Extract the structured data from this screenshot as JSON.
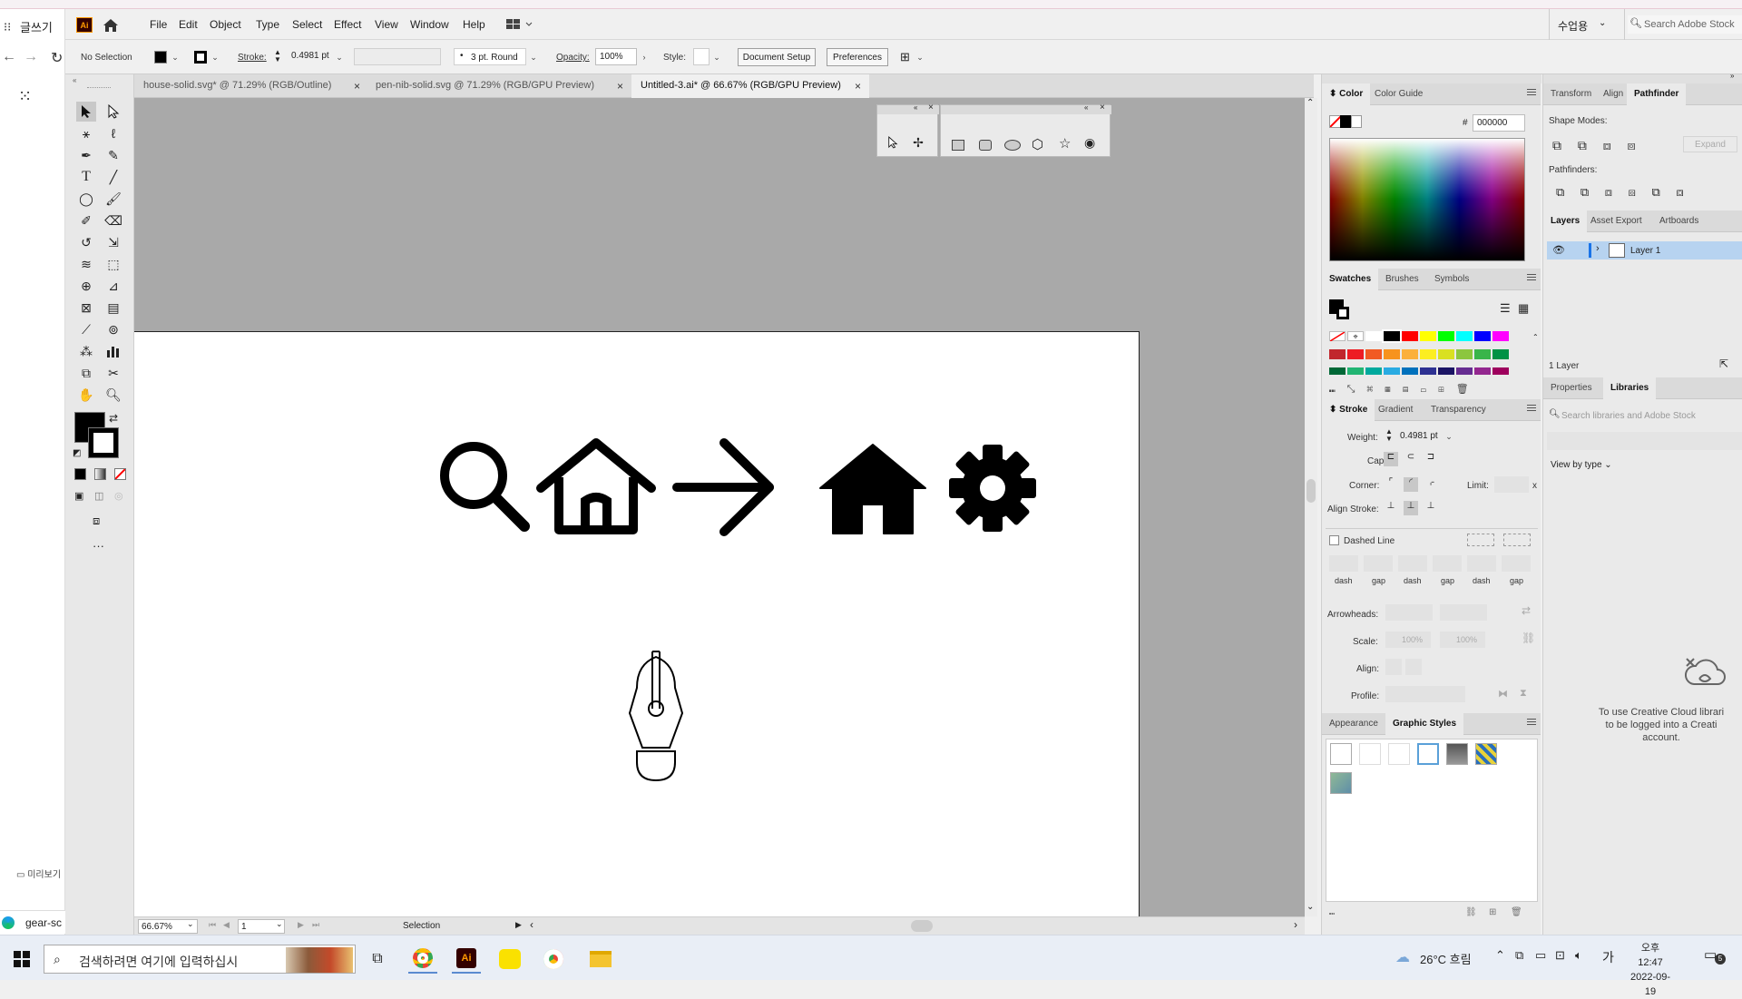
{
  "left_app": {
    "title": "글쓰기",
    "preview_label": "미리보기",
    "bottom_tab": "gear-sc"
  },
  "app": {
    "logo": "Ai"
  },
  "menu": [
    "File",
    "Edit",
    "Object",
    "Type",
    "Select",
    "Effect",
    "View",
    "Window",
    "Help"
  ],
  "header_right": {
    "workspace": "수업용",
    "search_placeholder": "Search Adobe Stock"
  },
  "control": {
    "selection": "No Selection",
    "stroke_label": "Stroke:",
    "stroke_value": "0.4981 pt",
    "brush": "3 pt. Round",
    "opacity_label": "Opacity:",
    "opacity_value": "100%",
    "style_label": "Style:",
    "doc_setup": "Document Setup",
    "preferences": "Preferences"
  },
  "tabs": [
    {
      "label": "house-solid.svg* @ 71.29% (RGB/Outline)",
      "active": false
    },
    {
      "label": "pen-nib-solid.svg @ 71.29% (RGB/GPU Preview)",
      "active": false
    },
    {
      "label": "Untitled-3.ai* @ 66.67% (RGB/GPU Preview)",
      "active": true
    }
  ],
  "status": {
    "zoom": "66.67%",
    "artboard": "1",
    "tool": "Selection"
  },
  "color_panel": {
    "tabs": [
      "Color",
      "Color Guide"
    ],
    "hex_label": "#",
    "hex": "000000"
  },
  "swatches_panel": {
    "tabs": [
      "Swatches",
      "Brushes",
      "Symbols"
    ]
  },
  "stroke_panel": {
    "tabs": [
      "Stroke",
      "Gradient",
      "Transparency"
    ],
    "weight_label": "Weight:",
    "weight_value": "0.4981 pt",
    "cap_label": "Cap:",
    "corner_label": "Corner:",
    "limit_label": "Limit:",
    "limit_x": "x",
    "align_label": "Align Stroke:",
    "dashed_label": "Dashed Line",
    "dash_labels": [
      "dash",
      "gap",
      "dash",
      "gap",
      "dash",
      "gap"
    ],
    "arrowheads_label": "Arrowheads:",
    "scale_label": "Scale:",
    "scale1": "100%",
    "scale2": "100%",
    "align2_label": "Align:",
    "profile_label": "Profile:"
  },
  "appearance_panel": {
    "tabs": [
      "Appearance",
      "Graphic Styles"
    ]
  },
  "pathfinder_panel": {
    "tabs": [
      "Transform",
      "Align",
      "Pathfinder"
    ],
    "shape_modes": "Shape Modes:",
    "expand": "Expand",
    "pathfinders": "Pathfinders:"
  },
  "layers_panel": {
    "tabs": [
      "Layers",
      "Asset Export",
      "Artboards"
    ],
    "layer_name": "Layer 1",
    "count": "1 Layer"
  },
  "libraries_panel": {
    "tabs": [
      "Properties",
      "Libraries"
    ],
    "search_placeholder": "Search libraries and Adobe Stock",
    "view_by": "View by type",
    "message_lines": [
      "To use Creative Cloud librari",
      "to be logged into a Creati",
      "account."
    ]
  },
  "taskbar": {
    "search_placeholder": "검색하려면 여기에 입력하십시",
    "weather": "26°C  흐림",
    "ime": "가",
    "time": "오후 12:47",
    "date": "2022-09-19",
    "notifications": "5"
  },
  "colors": {
    "accent": "#1473e6",
    "layer_highlight": "#b7d3f0",
    "canvas": "#a9a9a9"
  }
}
